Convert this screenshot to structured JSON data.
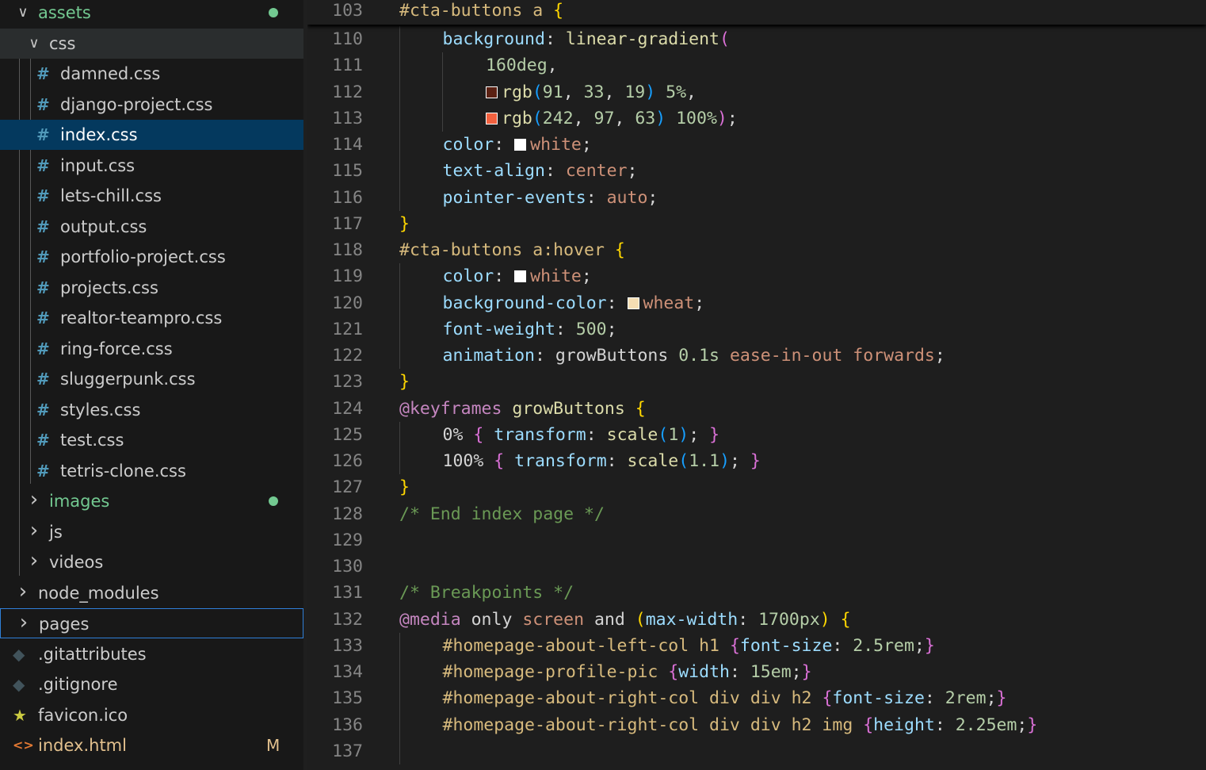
{
  "explorer": {
    "rows": [
      {
        "type": "folder",
        "name": "assets",
        "expanded": true,
        "level": 0,
        "git": true,
        "dot": true
      },
      {
        "type": "folder",
        "name": "css",
        "expanded": true,
        "level": 1,
        "hover": true
      },
      {
        "type": "css",
        "name": "damned.css",
        "level": 2
      },
      {
        "type": "css",
        "name": "django-project.css",
        "level": 2
      },
      {
        "type": "css",
        "name": "index.css",
        "level": 2,
        "selected": true
      },
      {
        "type": "css",
        "name": "input.css",
        "level": 2
      },
      {
        "type": "css",
        "name": "lets-chill.css",
        "level": 2
      },
      {
        "type": "css",
        "name": "output.css",
        "level": 2
      },
      {
        "type": "css",
        "name": "portfolio-project.css",
        "level": 2
      },
      {
        "type": "css",
        "name": "projects.css",
        "level": 2
      },
      {
        "type": "css",
        "name": "realtor-teampro.css",
        "level": 2
      },
      {
        "type": "css",
        "name": "ring-force.css",
        "level": 2
      },
      {
        "type": "css",
        "name": "sluggerpunk.css",
        "level": 2
      },
      {
        "type": "css",
        "name": "styles.css",
        "level": 2
      },
      {
        "type": "css",
        "name": "test.css",
        "level": 2
      },
      {
        "type": "css",
        "name": "tetris-clone.css",
        "level": 2
      },
      {
        "type": "folder",
        "name": "images",
        "expanded": false,
        "level": 1,
        "git": true,
        "dot": true
      },
      {
        "type": "folder",
        "name": "js",
        "expanded": false,
        "level": 1
      },
      {
        "type": "folder",
        "name": "videos",
        "expanded": false,
        "level": 1
      },
      {
        "type": "folder",
        "name": "node_modules",
        "expanded": false,
        "level": 0
      },
      {
        "type": "folder",
        "name": "pages",
        "expanded": false,
        "level": 0,
        "focused": true
      },
      {
        "type": "git-file",
        "name": ".gitattributes",
        "level": 0
      },
      {
        "type": "git-file",
        "name": ".gitignore",
        "level": 0
      },
      {
        "type": "star",
        "name": "favicon.ico",
        "level": 0
      },
      {
        "type": "html",
        "name": "index.html",
        "level": 0,
        "badge": "M",
        "modified": true
      }
    ],
    "colors": {
      "css_hash": "#519aba",
      "git_added": "#73c991",
      "modified": "#e2c08d",
      "selection": "#04395e"
    }
  },
  "editor": {
    "sticky": {
      "ln": "103",
      "tokens": [
        [
          "t-sel",
          "#cta-buttons a "
        ],
        [
          "t-b1",
          "{"
        ]
      ]
    },
    "lines": [
      {
        "ln": "110",
        "indent": 1,
        "tokens": [
          [
            "t-prop",
            "background"
          ],
          [
            "t-txt",
            ": "
          ],
          [
            "t-fn",
            "linear-gradient"
          ],
          [
            "t-b2",
            "("
          ]
        ]
      },
      {
        "ln": "111",
        "indent": 2,
        "tokens": [
          [
            "t-num",
            "160deg"
          ],
          [
            "t-txt",
            ","
          ]
        ]
      },
      {
        "ln": "112",
        "indent": 2,
        "swatch": "#5b2113",
        "tokens": [
          [
            "t-fn",
            "rgb"
          ],
          [
            "t-b3",
            "("
          ],
          [
            "t-num",
            "91"
          ],
          [
            "t-txt",
            ", "
          ],
          [
            "t-num",
            "33"
          ],
          [
            "t-txt",
            ", "
          ],
          [
            "t-num",
            "19"
          ],
          [
            "t-b3",
            ")"
          ],
          [
            "t-txt",
            " "
          ],
          [
            "t-num",
            "5%"
          ],
          [
            "t-txt",
            ","
          ]
        ]
      },
      {
        "ln": "113",
        "indent": 2,
        "swatch": "#f2613f",
        "tokens": [
          [
            "t-fn",
            "rgb"
          ],
          [
            "t-b3",
            "("
          ],
          [
            "t-num",
            "242"
          ],
          [
            "t-txt",
            ", "
          ],
          [
            "t-num",
            "97"
          ],
          [
            "t-txt",
            ", "
          ],
          [
            "t-num",
            "63"
          ],
          [
            "t-b3",
            ")"
          ],
          [
            "t-txt",
            " "
          ],
          [
            "t-num",
            "100%"
          ],
          [
            "t-b2",
            ")"
          ],
          [
            "t-txt",
            ";"
          ]
        ]
      },
      {
        "ln": "114",
        "indent": 1,
        "tokens": [
          [
            "t-prop",
            "color"
          ],
          [
            "t-txt",
            ": "
          ],
          [
            "swatch",
            "#ffffff"
          ],
          [
            "t-val",
            "white"
          ],
          [
            "t-txt",
            ";"
          ]
        ]
      },
      {
        "ln": "115",
        "indent": 1,
        "tokens": [
          [
            "t-prop",
            "text-align"
          ],
          [
            "t-txt",
            ": "
          ],
          [
            "t-val",
            "center"
          ],
          [
            "t-txt",
            ";"
          ]
        ]
      },
      {
        "ln": "116",
        "indent": 1,
        "tokens": [
          [
            "t-prop",
            "pointer-events"
          ],
          [
            "t-txt",
            ": "
          ],
          [
            "t-val",
            "auto"
          ],
          [
            "t-txt",
            ";"
          ]
        ]
      },
      {
        "ln": "117",
        "indent": 0,
        "tokens": [
          [
            "t-b1",
            "}"
          ]
        ]
      },
      {
        "ln": "118",
        "indent": 0,
        "tokens": [
          [
            "t-sel",
            "#cta-buttons a:hover "
          ],
          [
            "t-b1",
            "{"
          ]
        ]
      },
      {
        "ln": "119",
        "indent": 1,
        "tokens": [
          [
            "t-prop",
            "color"
          ],
          [
            "t-txt",
            ": "
          ],
          [
            "swatch",
            "#ffffff"
          ],
          [
            "t-val",
            "white"
          ],
          [
            "t-txt",
            ";"
          ]
        ]
      },
      {
        "ln": "120",
        "indent": 1,
        "tokens": [
          [
            "t-prop",
            "background-color"
          ],
          [
            "t-txt",
            ": "
          ],
          [
            "swatch",
            "#f5deb3"
          ],
          [
            "t-val",
            "wheat"
          ],
          [
            "t-txt",
            ";"
          ]
        ]
      },
      {
        "ln": "121",
        "indent": 1,
        "tokens": [
          [
            "t-prop",
            "font-weight"
          ],
          [
            "t-txt",
            ": "
          ],
          [
            "t-num",
            "500"
          ],
          [
            "t-txt",
            ";"
          ]
        ]
      },
      {
        "ln": "122",
        "indent": 1,
        "tokens": [
          [
            "t-prop",
            "animation"
          ],
          [
            "t-txt",
            ": growButtons "
          ],
          [
            "t-num",
            "0.1s"
          ],
          [
            "t-txt",
            " "
          ],
          [
            "t-val",
            "ease-in-out"
          ],
          [
            "t-txt",
            " "
          ],
          [
            "t-val",
            "forwards"
          ],
          [
            "t-txt",
            ";"
          ]
        ]
      },
      {
        "ln": "123",
        "indent": 0,
        "tokens": [
          [
            "t-b1",
            "}"
          ]
        ]
      },
      {
        "ln": "124",
        "indent": 0,
        "tokens": [
          [
            "t-kw",
            "@keyframes"
          ],
          [
            "t-txt",
            " "
          ],
          [
            "t-fn",
            "growButtons"
          ],
          [
            "t-txt",
            " "
          ],
          [
            "t-b1",
            "{"
          ]
        ]
      },
      {
        "ln": "125",
        "indent": 1,
        "tokens": [
          [
            "t-txt",
            "0% "
          ],
          [
            "t-b2",
            "{"
          ],
          [
            "t-txt",
            " "
          ],
          [
            "t-prop",
            "transform"
          ],
          [
            "t-txt",
            ": "
          ],
          [
            "t-fn",
            "scale"
          ],
          [
            "t-b3",
            "("
          ],
          [
            "t-num",
            "1"
          ],
          [
            "t-b3",
            ")"
          ],
          [
            "t-txt",
            "; "
          ],
          [
            "t-b2",
            "}"
          ]
        ]
      },
      {
        "ln": "126",
        "indent": 1,
        "tokens": [
          [
            "t-txt",
            "100% "
          ],
          [
            "t-b2",
            "{"
          ],
          [
            "t-txt",
            " "
          ],
          [
            "t-prop",
            "transform"
          ],
          [
            "t-txt",
            ": "
          ],
          [
            "t-fn",
            "scale"
          ],
          [
            "t-b3",
            "("
          ],
          [
            "t-num",
            "1.1"
          ],
          [
            "t-b3",
            ")"
          ],
          [
            "t-txt",
            "; "
          ],
          [
            "t-b2",
            "}"
          ]
        ]
      },
      {
        "ln": "127",
        "indent": 0,
        "tokens": [
          [
            "t-b1",
            "}"
          ]
        ]
      },
      {
        "ln": "128",
        "indent": 0,
        "tokens": [
          [
            "t-cm",
            "/* End index page */"
          ]
        ]
      },
      {
        "ln": "129",
        "indent": 0,
        "tokens": []
      },
      {
        "ln": "130",
        "indent": 0,
        "tokens": []
      },
      {
        "ln": "131",
        "indent": 0,
        "tokens": [
          [
            "t-cm",
            "/* Breakpoints */"
          ]
        ]
      },
      {
        "ln": "132",
        "indent": 0,
        "tokens": [
          [
            "t-kw",
            "@media"
          ],
          [
            "t-txt",
            " only "
          ],
          [
            "t-val",
            "screen"
          ],
          [
            "t-txt",
            " and "
          ],
          [
            "t-b1",
            "("
          ],
          [
            "t-prop",
            "max-width"
          ],
          [
            "t-txt",
            ": "
          ],
          [
            "t-num",
            "1700px"
          ],
          [
            "t-b1",
            ")"
          ],
          [
            "t-txt",
            " "
          ],
          [
            "t-b1",
            "{"
          ]
        ]
      },
      {
        "ln": "133",
        "indent": 1,
        "tokens": [
          [
            "t-sel",
            "#homepage-about-left-col h1 "
          ],
          [
            "t-b2",
            "{"
          ],
          [
            "t-prop",
            "font-size"
          ],
          [
            "t-txt",
            ": "
          ],
          [
            "t-num",
            "2.5rem"
          ],
          [
            "t-txt",
            ";"
          ],
          [
            "t-b2",
            "}"
          ]
        ]
      },
      {
        "ln": "134",
        "indent": 1,
        "tokens": [
          [
            "t-sel",
            "#homepage-profile-pic "
          ],
          [
            "t-b2",
            "{"
          ],
          [
            "t-prop",
            "width"
          ],
          [
            "t-txt",
            ": "
          ],
          [
            "t-num",
            "15em"
          ],
          [
            "t-txt",
            ";"
          ],
          [
            "t-b2",
            "}"
          ]
        ]
      },
      {
        "ln": "135",
        "indent": 1,
        "tokens": [
          [
            "t-sel",
            "#homepage-about-right-col div div h2 "
          ],
          [
            "t-b2",
            "{"
          ],
          [
            "t-prop",
            "font-size"
          ],
          [
            "t-txt",
            ": "
          ],
          [
            "t-num",
            "2rem"
          ],
          [
            "t-txt",
            ";"
          ],
          [
            "t-b2",
            "}"
          ]
        ]
      },
      {
        "ln": "136",
        "indent": 1,
        "tokens": [
          [
            "t-sel",
            "#homepage-about-right-col div div h2 img "
          ],
          [
            "t-b2",
            "{"
          ],
          [
            "t-prop",
            "height"
          ],
          [
            "t-txt",
            ": "
          ],
          [
            "t-num",
            "2.25em"
          ],
          [
            "t-txt",
            ";"
          ],
          [
            "t-b2",
            "}"
          ]
        ]
      },
      {
        "ln": "137",
        "indent": 0,
        "tokens": []
      }
    ]
  }
}
